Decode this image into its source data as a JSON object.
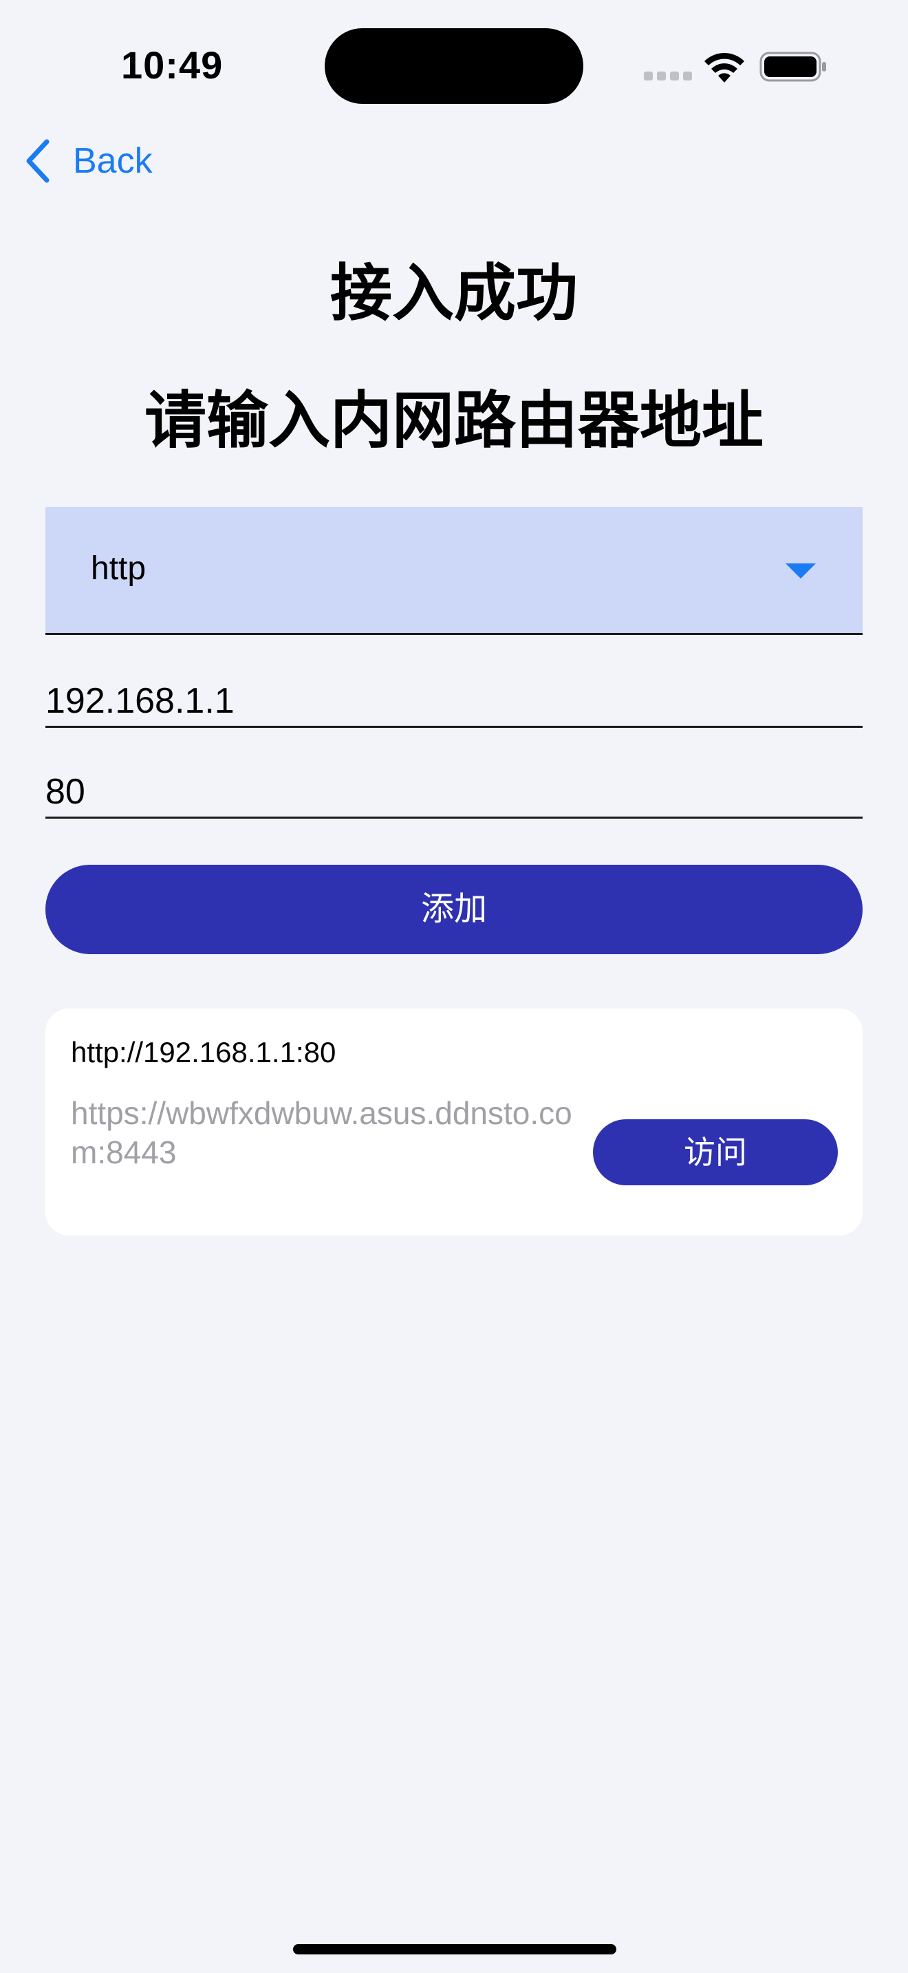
{
  "status_bar": {
    "time": "10:49",
    "signal_icon": "cellular-signal-icon",
    "wifi_icon": "wifi-icon",
    "battery_icon": "battery-icon"
  },
  "nav": {
    "back_label": "Back",
    "back_icon": "chevron-left-icon"
  },
  "title": {
    "line1": "接入成功",
    "line2": "请输入内网路由器地址"
  },
  "protocol": {
    "selected": "http",
    "arrow_icon": "dropdown-arrow-icon"
  },
  "ip_field": {
    "value": "192.168.1.1"
  },
  "port_field": {
    "value": "80"
  },
  "add_button": {
    "label": "添加"
  },
  "address_card": {
    "primary": "http://192.168.1.1:80",
    "secondary": "https://wbwfxdwbuw.asus.ddnsto.com:8443",
    "visit_label": "访问"
  },
  "colors": {
    "background": "#f3f4fa",
    "accent": "#2f32b0",
    "link_blue": "#1a7bf2",
    "dropdown_bg": "#cdd7f8",
    "muted_text": "#a0a0a6"
  }
}
